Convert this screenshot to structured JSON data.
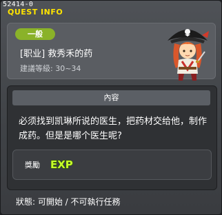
{
  "window": {
    "quest_id": "52414-0",
    "title": "QUEST INFO"
  },
  "quest": {
    "badge": "一般",
    "name": "[职业] 救秀禾的药",
    "level": "建議等級: 30~34"
  },
  "content": {
    "header": "內容",
    "text": "必须找到凯琳所说的医生，把药材交给他，制作成药。但是是哪个医生呢?"
  },
  "reward": {
    "label": "獎勵",
    "icon": "exp-icon",
    "exp_text": "EXP"
  },
  "status": "狀態: 可開始 / 不可執行任務",
  "colors": {
    "title": "#ffe400",
    "badge": "#8ab229",
    "exp": "#c6ff2a"
  }
}
